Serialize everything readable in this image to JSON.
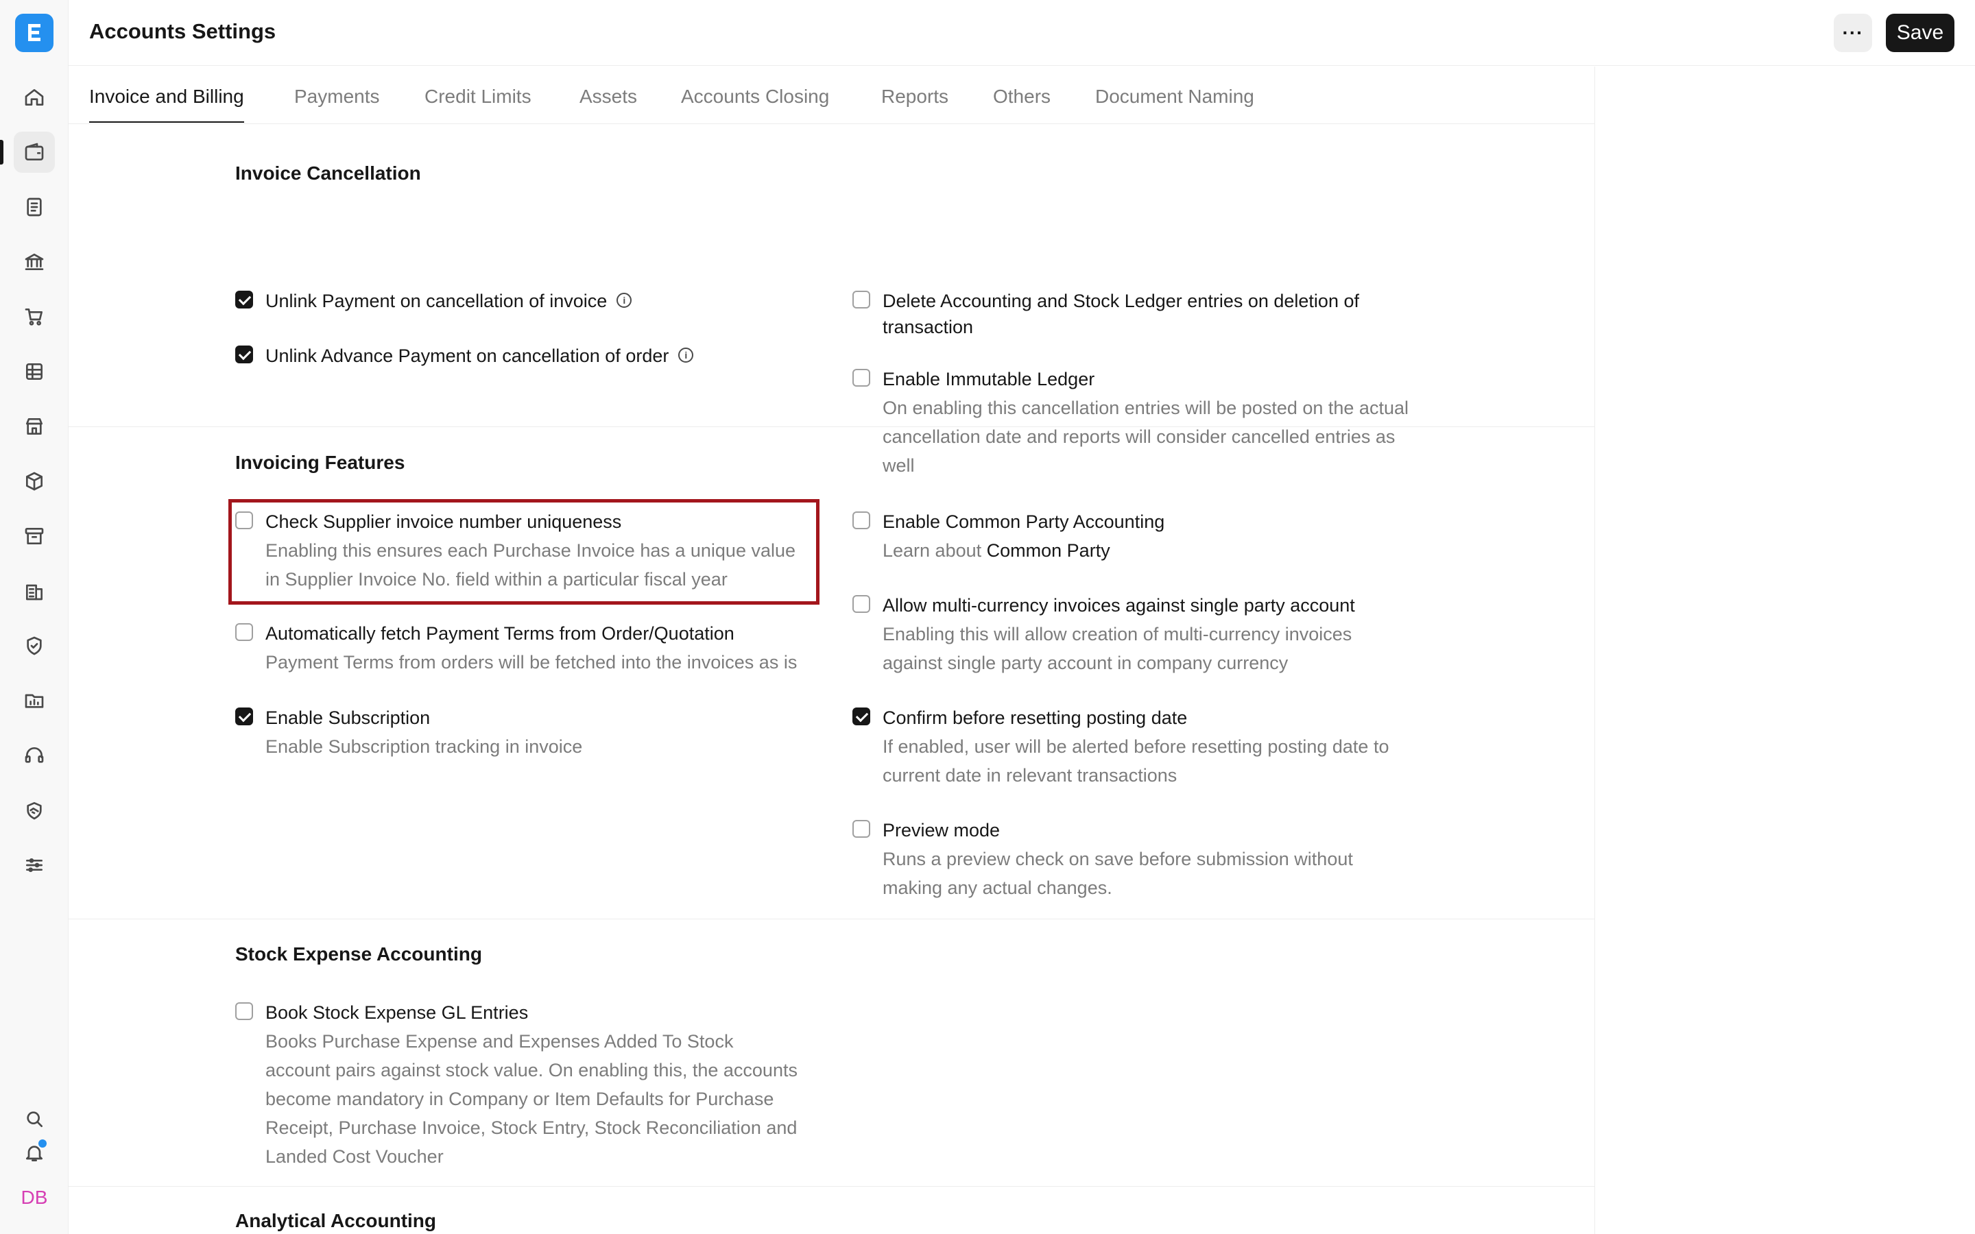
{
  "app": {
    "title": "Accounts Settings",
    "save_label": "Save",
    "more_label": "···",
    "avatar_initials": "DB"
  },
  "sidebar": {
    "items": [
      {
        "icon": "home-icon"
      },
      {
        "icon": "wallet-icon",
        "active": true
      },
      {
        "icon": "document-icon"
      },
      {
        "icon": "bank-icon"
      },
      {
        "icon": "cart-icon"
      },
      {
        "icon": "table-icon"
      },
      {
        "icon": "store-icon"
      },
      {
        "icon": "box-icon"
      },
      {
        "icon": "archive-icon"
      },
      {
        "icon": "building-icon"
      },
      {
        "icon": "shield-icon"
      },
      {
        "icon": "folder-chart-icon"
      },
      {
        "icon": "headset-icon"
      },
      {
        "icon": "handshake-icon"
      },
      {
        "icon": "sliders-icon"
      }
    ],
    "bottom": [
      {
        "icon": "search-icon"
      },
      {
        "icon": "bell-icon"
      }
    ]
  },
  "tabs": [
    {
      "label": "Invoice and Billing",
      "active": true
    },
    {
      "label": "Payments"
    },
    {
      "label": "Credit Limits"
    },
    {
      "label": "Assets"
    },
    {
      "label": "Accounts Closing"
    },
    {
      "label": "Reports"
    },
    {
      "label": "Others"
    },
    {
      "label": "Document Naming"
    }
  ],
  "sections": {
    "invoice_cancellation": {
      "title": "Invoice Cancellation",
      "fields": {
        "unlink_payment": {
          "label": "Unlink Payment on cancellation of invoice",
          "checked": true
        },
        "unlink_advance": {
          "label": "Unlink Advance Payment on cancellation of order",
          "checked": true
        },
        "delete_ledger_1": "Delete Accounting and Stock Ledger entries on deletion of",
        "delete_ledger_2": "transaction",
        "immutable_ledger": {
          "label": "Enable Immutable Ledger",
          "checked": false
        },
        "immutable_desc_1": "On enabling this cancellation entries will be posted on the actual",
        "immutable_desc_2": "cancellation date and reports will consider cancelled entries as",
        "immutable_desc_3": "well"
      }
    },
    "invoicing_features": {
      "title": "Invoicing Features",
      "fields": {
        "check_supplier": {
          "label": "Check Supplier invoice number uniqueness",
          "checked": false
        },
        "check_supplier_desc_1": "Enabling this ensures each Purchase Invoice has a unique value",
        "check_supplier_desc_2": "in Supplier Invoice No. field within a particular fiscal year",
        "auto_fetch": {
          "label": "Automatically fetch Payment Terms from Order/Quotation",
          "checked": false
        },
        "auto_fetch_desc": "Payment Terms from orders will be fetched into the invoices as is",
        "subscription": {
          "label": "Enable Subscription",
          "checked": true
        },
        "subscription_desc": "Enable Subscription tracking in invoice",
        "common_party": {
          "label": "Enable Common Party Accounting",
          "checked": false
        },
        "common_party_desc_prefix": "Learn about",
        "common_party_desc_link": "Common Party",
        "multi_currency": {
          "label": "Allow multi-currency invoices against single party account",
          "checked": false
        },
        "multi_currency_desc_1": "Enabling this will allow creation of multi-currency invoices",
        "multi_currency_desc_2": "against single party account in company currency",
        "confirm_reset": {
          "label": "Confirm before resetting posting date",
          "checked": true
        },
        "confirm_reset_desc_1": "If enabled, user will be alerted before resetting posting date to",
        "confirm_reset_desc_2": "current date in relevant transactions",
        "preview_mode": {
          "label": "Preview mode",
          "checked": false
        },
        "preview_desc_1": "Runs a preview check on save before submission without",
        "preview_desc_2": "making any actual changes."
      }
    },
    "stock_expense": {
      "title": "Stock Expense Accounting",
      "fields": {
        "book_stock": {
          "label": "Book Stock Expense GL Entries",
          "checked": false
        },
        "book_stock_desc_1": "Books Purchase Expense and Expenses Added To Stock",
        "book_stock_desc_2": "account pairs against stock value. On enabling this, the accounts",
        "book_stock_desc_3": "become mandatory in Company or Item Defaults for Purchase",
        "book_stock_desc_4": "Receipt, Purchase Invoice, Stock Entry, Stock Reconciliation and",
        "book_stock_desc_5": "Landed Cost Voucher"
      }
    },
    "analytical": {
      "title": "Analytical Accounting"
    }
  },
  "colors": {
    "accent": "#2490ef",
    "highlight": "#a3161c",
    "primary": "#171717",
    "muted": "#7c7c7c"
  }
}
